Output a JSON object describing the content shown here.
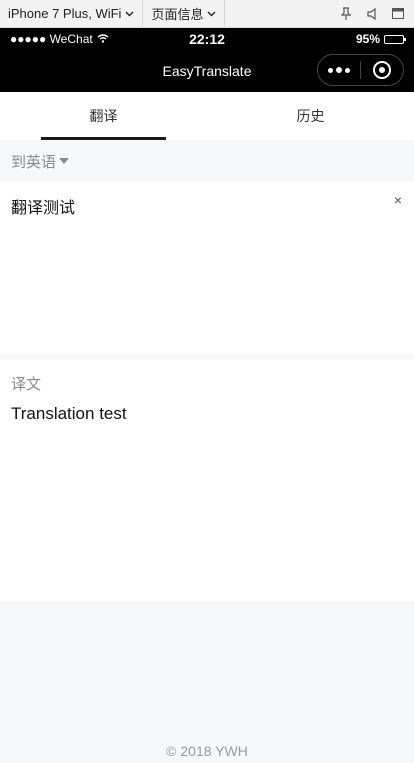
{
  "devtools": {
    "device": "iPhone 7 Plus, WiFi",
    "page_info": "页面信息"
  },
  "status_bar": {
    "signal": "●●●●● WeChat",
    "time": "22:12",
    "battery_percent": "95%",
    "battery_level": 0.95
  },
  "nav": {
    "title": "EasyTranslate"
  },
  "tabs": [
    {
      "label": "翻译",
      "active": true
    },
    {
      "label": "历史",
      "active": false
    }
  ],
  "translate": {
    "target_lang": "到英语",
    "input_value": "翻译测试",
    "clear_label": "×",
    "result_label": "译文",
    "result_text": "Translation test"
  },
  "footer": {
    "copyright": "© 2018 YWH"
  }
}
